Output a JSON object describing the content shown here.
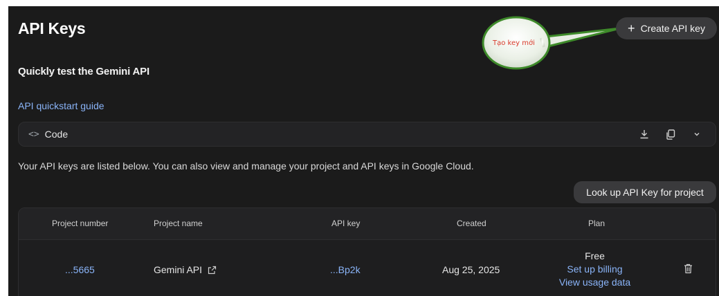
{
  "header": {
    "title": "API Keys",
    "create_label": "Create API key",
    "create_icon": "plus-icon"
  },
  "annotation": {
    "text": "Tạo key mới",
    "color": "#d93a2b"
  },
  "section": {
    "title": "Quickly test the Gemini API",
    "quickstart_label": "API quickstart guide"
  },
  "code": {
    "label": "Code",
    "icons": [
      "code-brackets-icon",
      "download-icon",
      "copy-icon",
      "chevron-down-icon"
    ]
  },
  "description": "Your API keys are listed below. You can also view and manage your project and API keys in Google Cloud.",
  "lookup_label": "Look up API Key for project",
  "table": {
    "headers": {
      "project_number": "Project number",
      "project_name": "Project name",
      "api_key": "API key",
      "created": "Created",
      "plan": "Plan"
    },
    "rows": [
      {
        "project_number": "...5665",
        "project_name": "Gemini API",
        "api_key": "...Bp2k",
        "created": "Aug 25, 2025",
        "plan": "Free",
        "billing_link": "Set up billing",
        "usage_link": "View usage data"
      }
    ]
  },
  "colors": {
    "background": "#1b1b1b",
    "link": "#8ab4f8",
    "button": "#3a3a3c"
  }
}
